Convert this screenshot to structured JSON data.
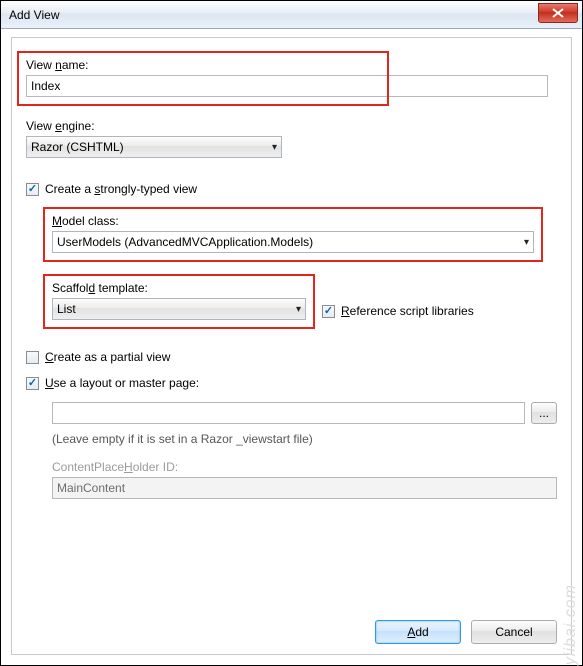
{
  "window": {
    "title": "Add View"
  },
  "viewName": {
    "label_pre": "View ",
    "label_u": "n",
    "label_post": "ame:",
    "value": "Index"
  },
  "viewEngine": {
    "label_pre": "View ",
    "label_u": "e",
    "label_post": "ngine:",
    "value": "Razor (CSHTML)"
  },
  "stronglyTyped": {
    "checked": true,
    "pre": "Create a ",
    "u": "s",
    "post": "trongly-typed view"
  },
  "modelClass": {
    "label_pre": "",
    "label_u": "M",
    "label_post": "odel class:",
    "value": "UserModels (AdvancedMVCApplication.Models)"
  },
  "scaffold": {
    "label_pre": "Scaffol",
    "label_u": "d",
    "label_post": " template:",
    "value": "List"
  },
  "refScripts": {
    "checked": true,
    "pre": "",
    "u": "R",
    "post": "eference script libraries"
  },
  "partial": {
    "checked": false,
    "pre": "",
    "u": "C",
    "post": "reate as a partial view"
  },
  "layout": {
    "checked": true,
    "pre": "",
    "u": "U",
    "post": "se a layout or master page:",
    "path": "",
    "help": "(Leave empty if it is set in a Razor _viewstart file)"
  },
  "placeholder": {
    "label_pre": "ContentPlace",
    "label_u": "H",
    "label_post": "older ID:",
    "value": "MainContent"
  },
  "buttons": {
    "add_u": "A",
    "add_post": "dd",
    "cancel": "Cancel",
    "browse": "..."
  },
  "watermark": "yiibai.com"
}
